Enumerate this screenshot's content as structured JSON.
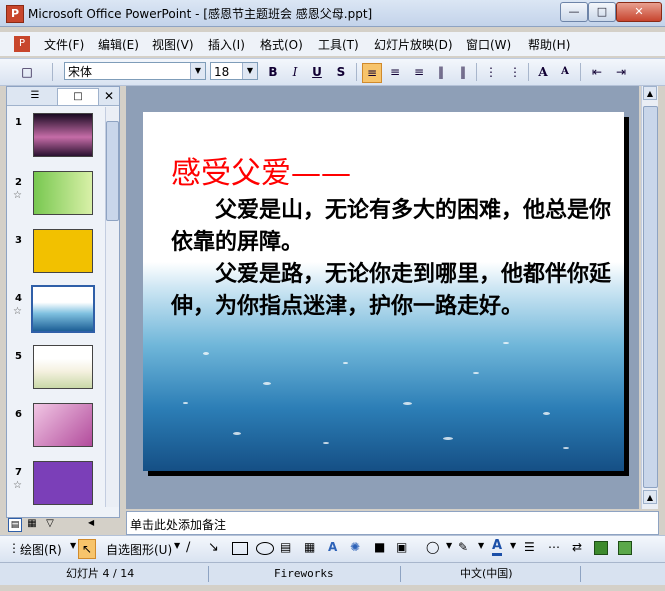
{
  "window": {
    "title": "Microsoft Office PowerPoint - [感恩节主题班会 感恩父母.ppt]",
    "app_icon": "powerpoint-icon"
  },
  "menu": [
    "文件(F)",
    "编辑(E)",
    "视图(V)",
    "插入(I)",
    "格式(O)",
    "工具(T)",
    "幻灯片放映(D)",
    "窗口(W)",
    "帮助(H)"
  ],
  "toolbar": {
    "font_name": "宋体",
    "font_size": "18",
    "bold": "B",
    "italic": "I",
    "underline": "U",
    "shadow": "S",
    "grow_font": "A",
    "shrink_font": "A"
  },
  "outline_panel": {
    "slides": [
      {
        "number": "1",
        "animated": false
      },
      {
        "number": "2",
        "animated": true
      },
      {
        "number": "3",
        "animated": false
      },
      {
        "number": "4",
        "animated": true,
        "selected": true
      },
      {
        "number": "5",
        "animated": false
      },
      {
        "number": "6",
        "animated": false
      },
      {
        "number": "7",
        "animated": true
      }
    ]
  },
  "slide": {
    "title": "感受父爱——",
    "paragraphs": [
      "父爱是山，无论有多大的困难，他总是你依靠的屏障。",
      "父爱是路，无论你走到哪里，他都伴你延伸，为你指点迷津，护你一路走好。"
    ],
    "colors": {
      "title": "#ff0000",
      "body": "#000000"
    }
  },
  "notes": {
    "placeholder": "单击此处添加备注"
  },
  "drawing_toolbar": {
    "draw_label": "绘图(R)",
    "autoshapes_label": "自选图形(U)"
  },
  "status": {
    "slide_indicator": "幻灯片 4 / 14",
    "design": "Fireworks",
    "language": "中文(中国)"
  }
}
